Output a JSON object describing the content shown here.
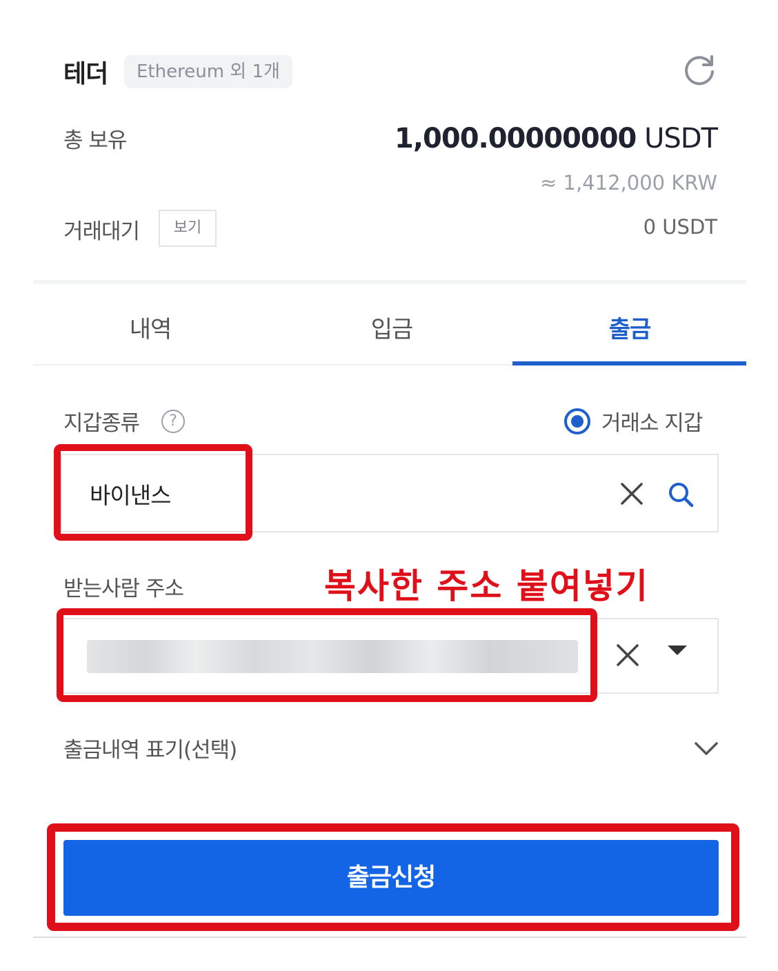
{
  "header": {
    "coin_name": "테더",
    "network_badge": "Ethereum 외 1개",
    "refresh_icon": "refresh-icon"
  },
  "balance": {
    "total_label": "총 보유",
    "total_amount": "1,000.00000000",
    "total_unit": "USDT",
    "total_krw": "≈ 1,412,000 KRW",
    "pending_label": "거래대기",
    "view_button": "보기",
    "pending_amount": "0 USDT"
  },
  "tabs": [
    {
      "label": "내역",
      "active": false
    },
    {
      "label": "입금",
      "active": false
    },
    {
      "label": "출금",
      "active": true
    }
  ],
  "withdraw": {
    "wallet_type_label": "지갑종류",
    "help_icon_glyph": "?",
    "exchange_wallet_label": "거래소 지갑",
    "exchange_wallet_selected": true,
    "exchange_value": "바이낸스",
    "recipient_label": "받는사람 주소",
    "recipient_value_blurred": true,
    "annotation": "복사한 주소 붙여넣기",
    "memo_label": "출금내역 표기(선택)",
    "submit_label": "출금신청"
  },
  "colors": {
    "accent": "#1f5fcc",
    "button": "#1464e6",
    "highlight": "#e0101a"
  }
}
